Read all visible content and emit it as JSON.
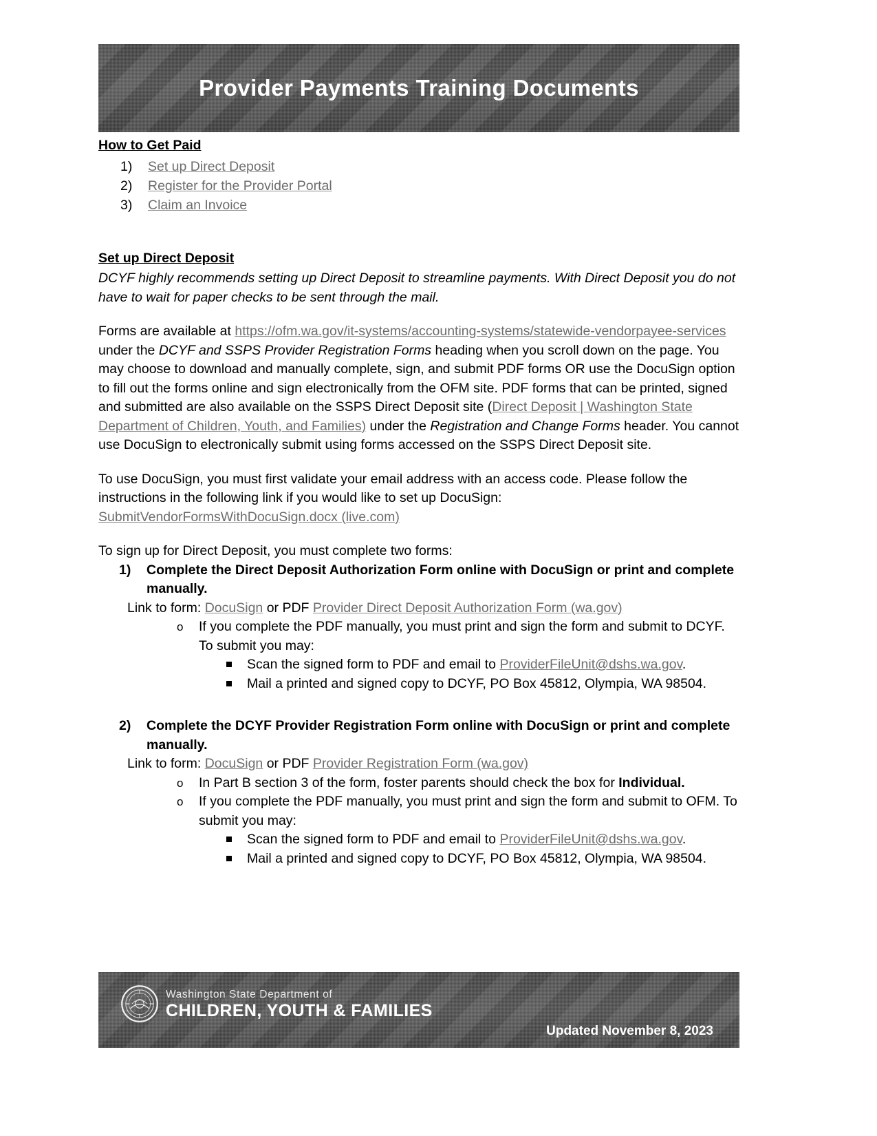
{
  "header": {
    "title": "Provider Payments Training Documents"
  },
  "how_to_get_paid": {
    "heading": "How to Get Paid",
    "items": [
      {
        "num": "1)",
        "label": "Set up Direct Deposit"
      },
      {
        "num": "2)",
        "label": "Register for the Provider Portal"
      },
      {
        "num": "3)",
        "label": "Claim an Invoice"
      }
    ]
  },
  "direct_deposit": {
    "heading": "Set up Direct Deposit",
    "intro_italic": "DCYF highly recommends setting up Direct Deposit to streamline payments. With Direct Deposit you do not have to wait for paper checks to be sent through the mail.",
    "forms_para": {
      "lead": "Forms are available at ",
      "url_link": "https://ofm.wa.gov/it-systems/accounting-systems/statewide-vendorpayee-services",
      "after_url": " under the ",
      "italic_1": "DCYF and SSPS Provider Registration Forms",
      "mid_1": " heading when you scroll down on the page. You may choose to download and manually complete, sign, and submit PDF forms OR use the DocuSign option to fill out the forms online and sign electronically from the OFM site. PDF forms that can be printed, signed and submitted are also available on the SSPS Direct Deposit site (",
      "site_link": "Direct Deposit | Washington State Department of Children, Youth, and Families)",
      "mid_2": " under the ",
      "italic_2": "Registration and Change Forms",
      "tail": " header. You cannot use DocuSign to electronically submit using forms accessed on the SSPS Direct Deposit site."
    },
    "docusign_para": {
      "text": "To use DocuSign, you must first validate your email address with an access code. Please follow the instructions in the following link if you would like to set up DocuSign:",
      "link": "SubmitVendorFormsWithDocuSign.docx (live.com)"
    },
    "signup_lead": "To sign up for Direct Deposit, you  must complete two forms:",
    "forms": [
      {
        "num": "1)",
        "title": "Complete the Direct Deposit Authorization Form online with DocuSign or print and complete manually.",
        "link_line": {
          "lead": "Link to form: ",
          "docusign_link": "DocuSign",
          "mid": " or PDF ",
          "pdf_link": "Provider Direct Deposit Authorization Form (wa.gov)"
        },
        "bullets": [
          {
            "marker": "o",
            "text": "If you complete the PDF manually, you must print and sign the form and submit to DCYF. To submit you may:",
            "bold_tail": "",
            "children": [
              {
                "lead": "Scan the signed form to PDF and email to ",
                "link": "ProviderFileUnit@dshs.wa.gov",
                "tail": "."
              },
              {
                "lead": "Mail a printed and signed copy to DCYF, PO Box 45812, Olympia, WA 98504.",
                "link": "",
                "tail": ""
              }
            ]
          }
        ]
      },
      {
        "num": "2)",
        "title": "Complete the DCYF Provider Registration Form online with DocuSign or print and complete manually.",
        "link_line": {
          "lead": "Link to form: ",
          "docusign_link": "DocuSign",
          "mid": " or PDF ",
          "pdf_link": "Provider Registration Form (wa.gov)"
        },
        "bullets": [
          {
            "marker": "o",
            "text": "In Part B section 3 of the form, foster parents should check the box for ",
            "bold_tail": "Individual.",
            "children": []
          },
          {
            "marker": "o",
            "text": "If you complete the PDF manually, you must print and sign the form and submit to OFM. To submit you may:",
            "bold_tail": "",
            "children": [
              {
                "lead": "Scan the signed form to PDF and email to ",
                "link": "ProviderFileUnit@dshs.wa.gov",
                "tail": "."
              },
              {
                "lead": "Mail a printed and signed copy to DCYF, PO Box 45812, Olympia, WA 98504.",
                "link": "",
                "tail": ""
              }
            ]
          }
        ]
      }
    ]
  },
  "footer": {
    "dept_small": "Washington State Department of",
    "dept_large": "CHILDREN, YOUTH & FAMILIES",
    "updated": "Updated November 8, 2023",
    "logo_icon": "wa-state-seal-icon"
  },
  "colors": {
    "banner": "#4a4a4a",
    "link": "#6d6d6d",
    "text": "#000000"
  }
}
